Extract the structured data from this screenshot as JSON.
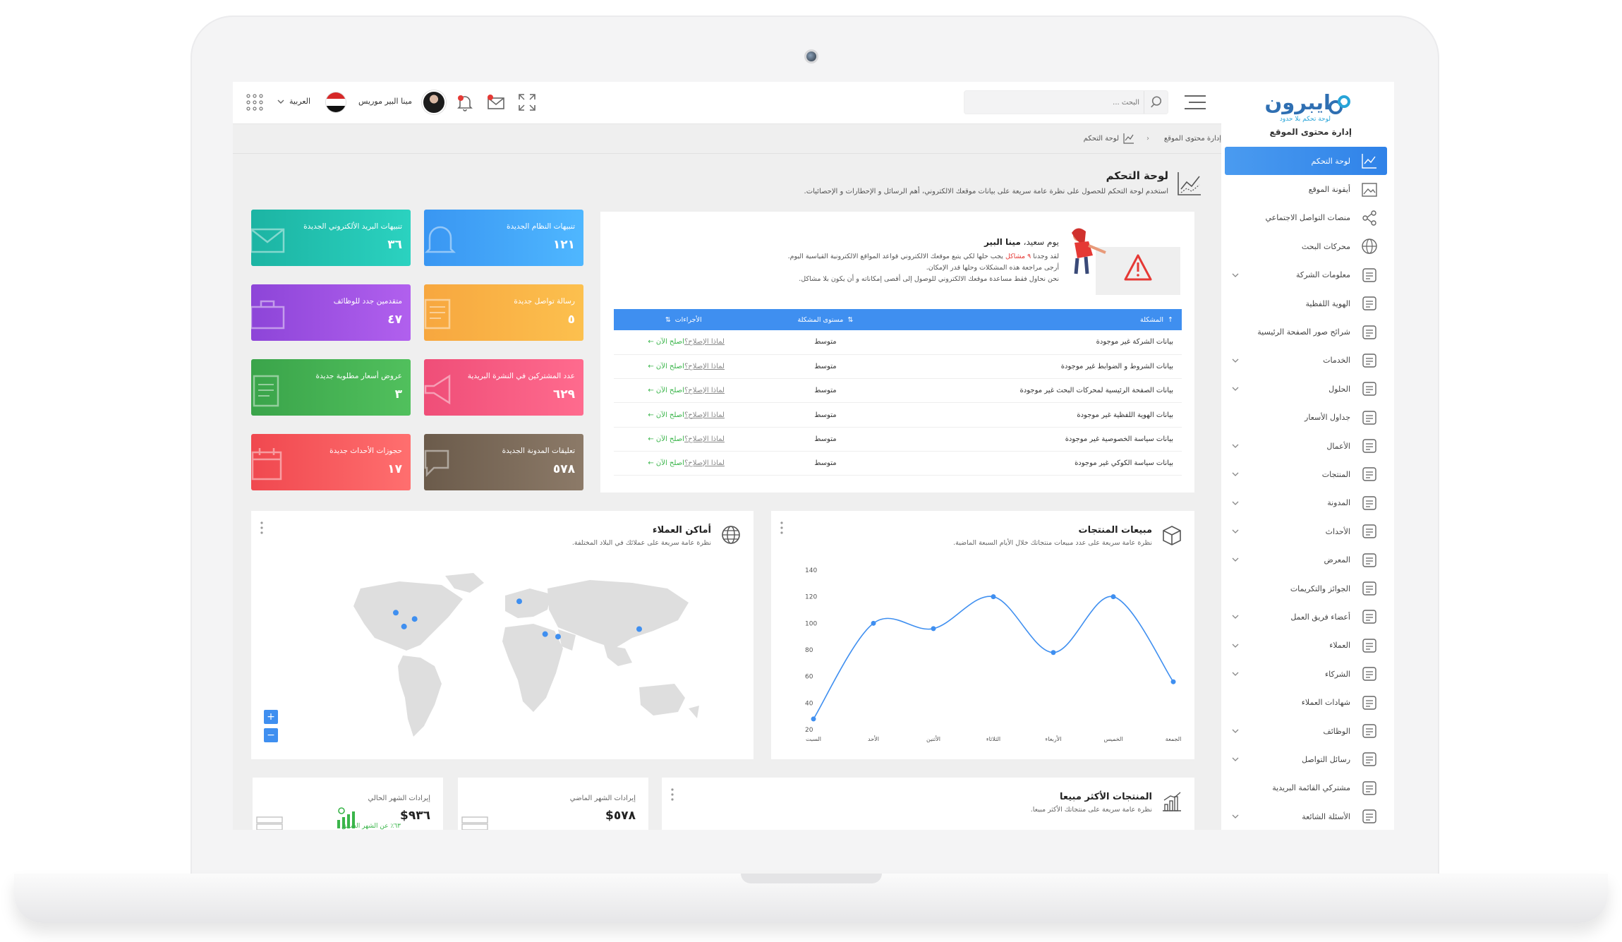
{
  "sidebar": {
    "logo_name": "ايبرون",
    "logo_tagline": "لوحة تحكم بلا حدود",
    "title": "إدارة محتوى الموقع",
    "items": [
      {
        "label": "لوحة التحكم",
        "icon": "chart-icon",
        "active": true,
        "has_submenu": false
      },
      {
        "label": "أيقونة الموقع",
        "icon": "image-icon",
        "has_submenu": false
      },
      {
        "label": "منصات التواصل الاجتماعي",
        "icon": "share-icon",
        "has_submenu": false
      },
      {
        "label": "محركات البحث",
        "icon": "globe-icon",
        "has_submenu": false
      },
      {
        "label": "معلومات الشركة",
        "icon": "building-icon",
        "has_submenu": true
      },
      {
        "label": "الهوية اللفظية",
        "icon": "microphone-icon",
        "has_submenu": false
      },
      {
        "label": "شرائح صور الصفحة الرئيسية",
        "icon": "slides-icon",
        "has_submenu": false
      },
      {
        "label": "الخدمات",
        "icon": "search-icon",
        "has_submenu": true
      },
      {
        "label": "الحلول",
        "icon": "puzzle-icon",
        "has_submenu": true
      },
      {
        "label": "جداول الأسعار",
        "icon": "price-tag-icon",
        "has_submenu": false
      },
      {
        "label": "الأعمال",
        "icon": "portfolio-icon",
        "has_submenu": true
      },
      {
        "label": "المنتجات",
        "icon": "box-icon",
        "has_submenu": true
      },
      {
        "label": "المدونة",
        "icon": "blog-icon",
        "has_submenu": true
      },
      {
        "label": "الأحداث",
        "icon": "calendar-icon",
        "has_submenu": true
      },
      {
        "label": "المعرض",
        "icon": "gallery-icon",
        "has_submenu": true
      },
      {
        "label": "الجوائز والتكريمات",
        "icon": "award-icon",
        "has_submenu": false
      },
      {
        "label": "أعضاء فريق العمل",
        "icon": "team-icon",
        "has_submenu": true
      },
      {
        "label": "العملاء",
        "icon": "handshake-icon",
        "has_submenu": true
      },
      {
        "label": "الشركاء",
        "icon": "partners-icon",
        "has_submenu": true
      },
      {
        "label": "شهادات العملاء",
        "icon": "testimonial-icon",
        "has_submenu": false
      },
      {
        "label": "الوظائف",
        "icon": "briefcase-icon",
        "has_submenu": true
      },
      {
        "label": "رسائل التواصل",
        "icon": "messages-icon",
        "has_submenu": true
      },
      {
        "label": "مشتركي القائمة البريدية",
        "icon": "newsletter-icon",
        "has_submenu": false
      },
      {
        "label": "الأسئلة الشائعة",
        "icon": "question-icon",
        "has_submenu": true
      }
    ]
  },
  "topbar": {
    "search_placeholder": "البحث ...",
    "user_name": "مينا البير موريس",
    "language": "العربية"
  },
  "breadcrumb": {
    "home": "إدارة محتوى الموقع",
    "separator": "‹",
    "current": "لوحة التحكم"
  },
  "page": {
    "title": "لوحة التحكم",
    "description": "استخدم لوحة التحكم للحصول على نظرة عامة سريعة على بيانات موقعك الالكتروني، أهم الرسائل و الإحطارات و الإحصائيات."
  },
  "alerts": {
    "greeting_prefix": "يوم سعيد،",
    "greeting_name": "مينا البير",
    "line1_prefix": "لقد وجدنا",
    "line1_highlight": "٩ مشاكل",
    "line1_suffix": "يجب حلها لكي يتبع موقعك الالكتروني قواعد المواقع الالكترونية القياسية اليوم.",
    "line2": "أرجى مراجعة هذه المشكلات وحلها قدر الإمكان.",
    "line3": "نحن نحاول فقط مساعدة موقعك الالكتروني للوصول إلى أقصى إمكاناته و أن يكون بلا مشاكل.",
    "columns": [
      "المشكلة",
      "مستوى المشكلة",
      "الأجراءات"
    ],
    "why_label": "لماذا الإصلاح؟",
    "fix_label": "اصلح الآن",
    "rows": [
      {
        "issue": "بيانات الشركة غير موجودة",
        "level": "متوسط"
      },
      {
        "issue": "بيانات الشروط و الضوابط غير موجودة",
        "level": "متوسط"
      },
      {
        "issue": "بيانات الصفحة الرئيسية لمحركات البحث غير موجودة",
        "level": "متوسط"
      },
      {
        "issue": "بيانات الهوية اللفظية غير موجودة",
        "level": "متوسط"
      },
      {
        "issue": "بيانات سياسة الخصوصية غير موجودة",
        "level": "متوسط"
      },
      {
        "issue": "بيانات سياسة الكوكي غير موجودة",
        "level": "متوسط"
      }
    ]
  },
  "tiles": {
    "system": {
      "label": "تنبيهات النظام الجديدة",
      "value": "١٢١"
    },
    "email": {
      "label": "تنبيهات البريد الألكتروني الجديدة",
      "value": "٣٦"
    },
    "contact": {
      "label": "رسالة تواصل جديدة",
      "value": "٥"
    },
    "jobs": {
      "label": "متقدمين جدد للوظائف",
      "value": "٤٧"
    },
    "news": {
      "label": "عدد المشتركين في النشرة البريدية",
      "value": "٦٢٩"
    },
    "quotes": {
      "label": "عروض أسعار مطلوبة جديدة",
      "value": "٣"
    },
    "blog": {
      "label": "تعليقات المدونة الجديدة",
      "value": "٥٧٨"
    },
    "events": {
      "label": "حجوزات الأحداث جديدة",
      "value": "١٧"
    }
  },
  "sales": {
    "title": "مبيعات المنتجات",
    "subtitle": "نظرة عامة سريعة على عدد مبيعات منتجاتك خلال الأيام السبعة الماضية."
  },
  "map": {
    "title": "أماكن العملاء",
    "subtitle": "نظرة عامة سريعة على عملائك في البلاد المختلفة.",
    "zoom_in": "+",
    "zoom_out": "−",
    "markers": [
      {
        "lat": 44,
        "lon": -93
      },
      {
        "lat": 33,
        "lon": -86
      },
      {
        "lat": 39,
        "lon": -77
      },
      {
        "lat": 53,
        "lon": 12
      },
      {
        "lat": 27,
        "lon": 34
      },
      {
        "lat": 25,
        "lon": 45
      },
      {
        "lat": 31,
        "lon": 114
      }
    ]
  },
  "best_sellers": {
    "title": "المنتجات الأكثر مبيعا",
    "subtitle": "نظرة عامة سريعة على منتجاتك الأكثر مبيعا."
  },
  "revenue": {
    "current": {
      "label": "إيرادات الشهر الحالي",
      "value": "٩٣٦$",
      "trend": "٦٣٪ عن الشهر السابق"
    },
    "last": {
      "label": "إيرادات الشهر الماضي",
      "value": "٥٧٨$"
    }
  },
  "colors": {
    "primary": "#3f8ff0",
    "warning": "#f39c12",
    "success": "#3ab54a",
    "danger": "#e53935"
  },
  "chart_data": {
    "type": "line",
    "title": "",
    "categories": [
      "السبت",
      "الأحد",
      "الأثنين",
      "الثلاثاء",
      "الأربعاء",
      "الخميس",
      "الجمعة"
    ],
    "series": [
      {
        "values": [
          28,
          100,
          96,
          120,
          78,
          120,
          56
        ]
      }
    ],
    "ylim": [
      20,
      140
    ],
    "yticks": [
      20,
      40,
      60,
      80,
      100,
      120,
      140
    ],
    "grid": false,
    "color": "#3f8ff0"
  }
}
